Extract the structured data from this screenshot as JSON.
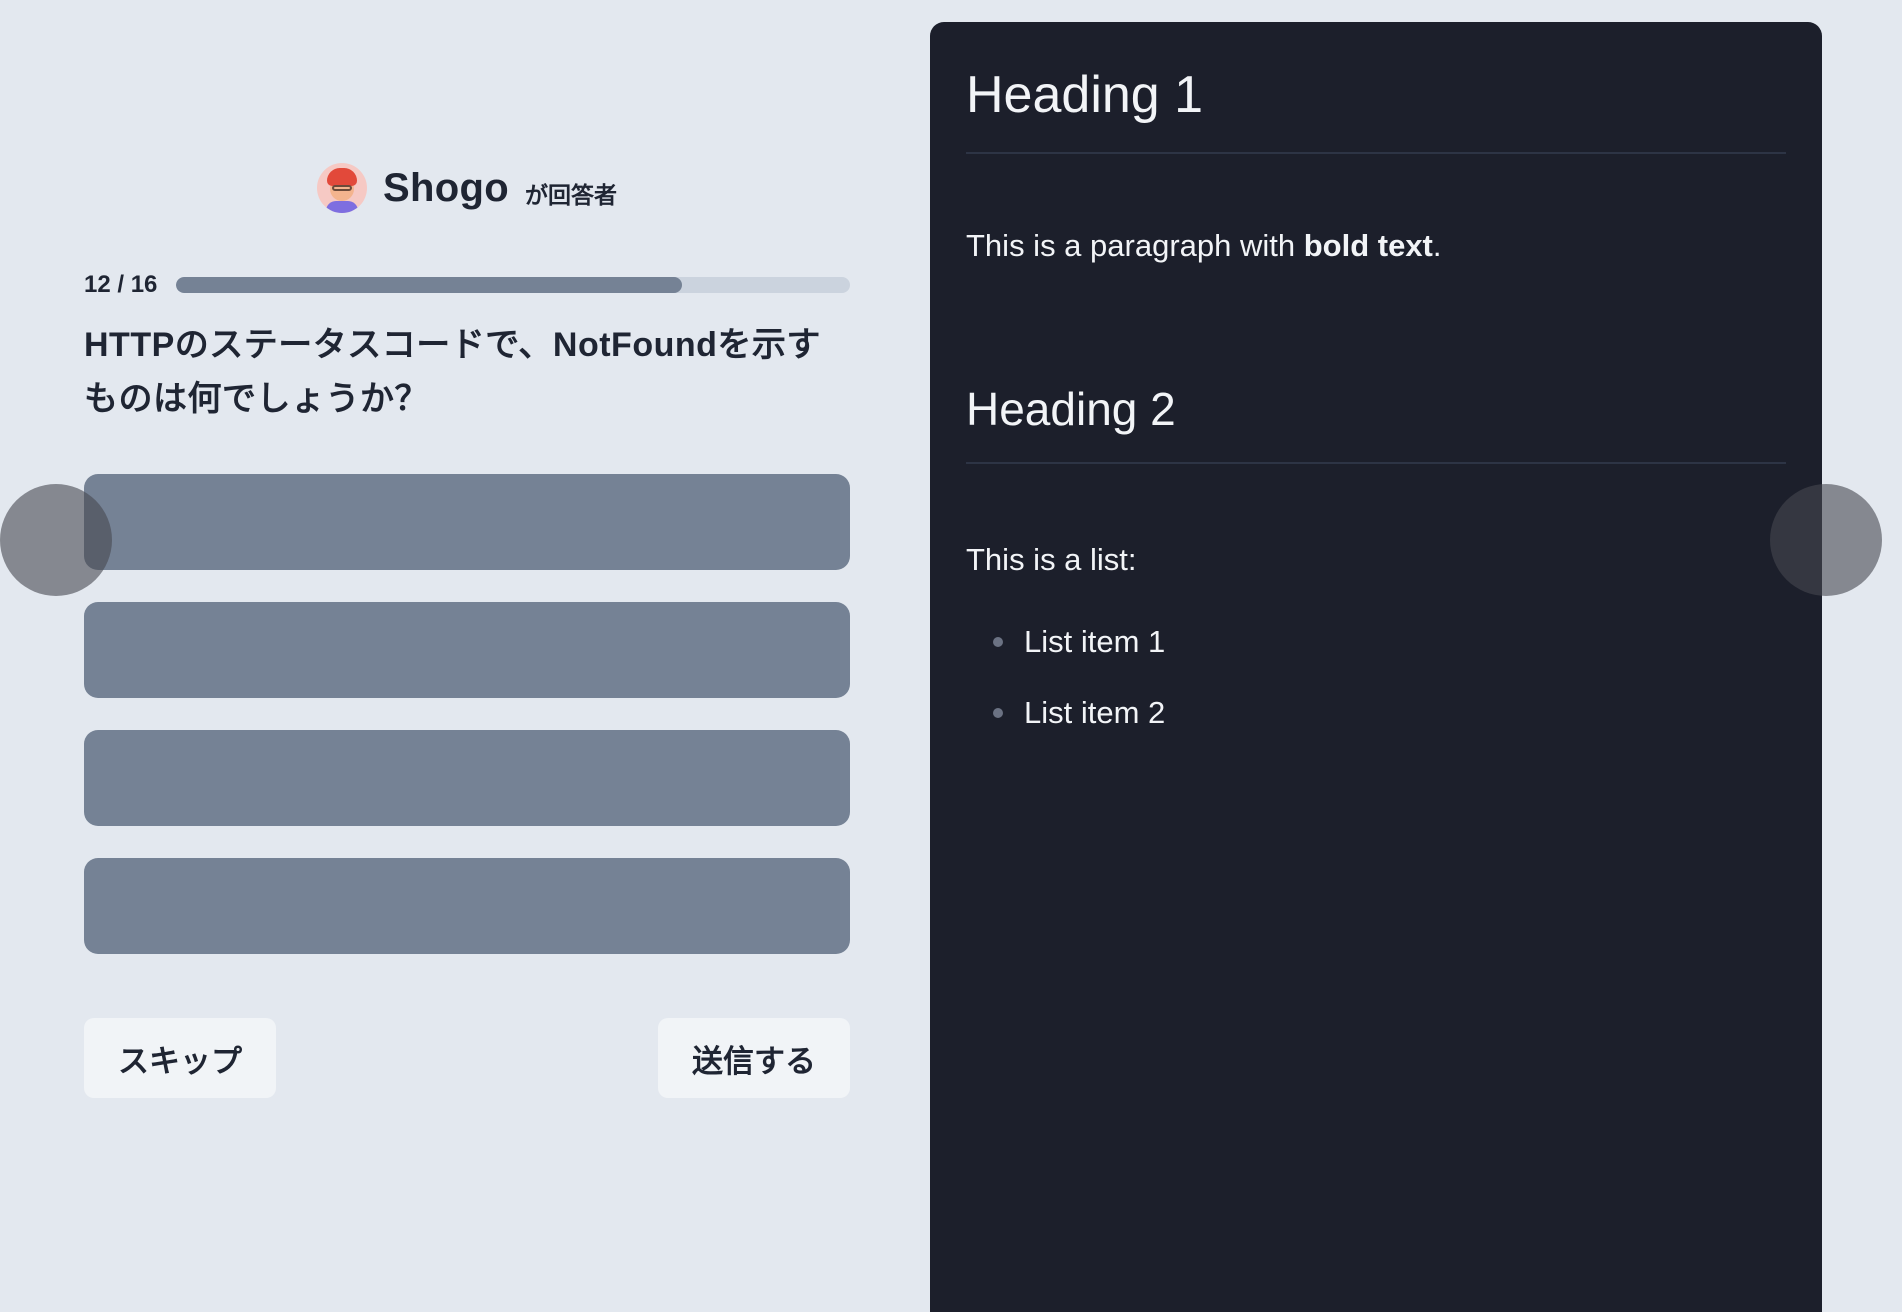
{
  "respondent": {
    "avatar": "avatar-icon",
    "name": "Shogo",
    "role": "が回答者"
  },
  "progress": {
    "label": "12 / 16",
    "current": 12,
    "total": 16,
    "fraction": 0.75
  },
  "question": {
    "text": "HTTPのステータスコードで、NotFoundを示すものは何でしょうか？"
  },
  "choices": [
    {
      "label": ""
    },
    {
      "label": ""
    },
    {
      "label": ""
    },
    {
      "label": ""
    }
  ],
  "actions": {
    "skip_label": "スキップ",
    "submit_label": "送信する"
  },
  "preview": {
    "heading1": "Heading 1",
    "paragraph_prefix": "This is a paragraph with ",
    "paragraph_bold": "bold text",
    "paragraph_suffix": ".",
    "heading2": "Heading 2",
    "list_intro": "This is a list:",
    "list_items": [
      "List item 1",
      "List item 2"
    ]
  },
  "colors": {
    "page_background": "#e3e8ef",
    "choice_fill": "#758295",
    "preview_background": "#1c1f2b",
    "text_dark": "#1f2533"
  }
}
